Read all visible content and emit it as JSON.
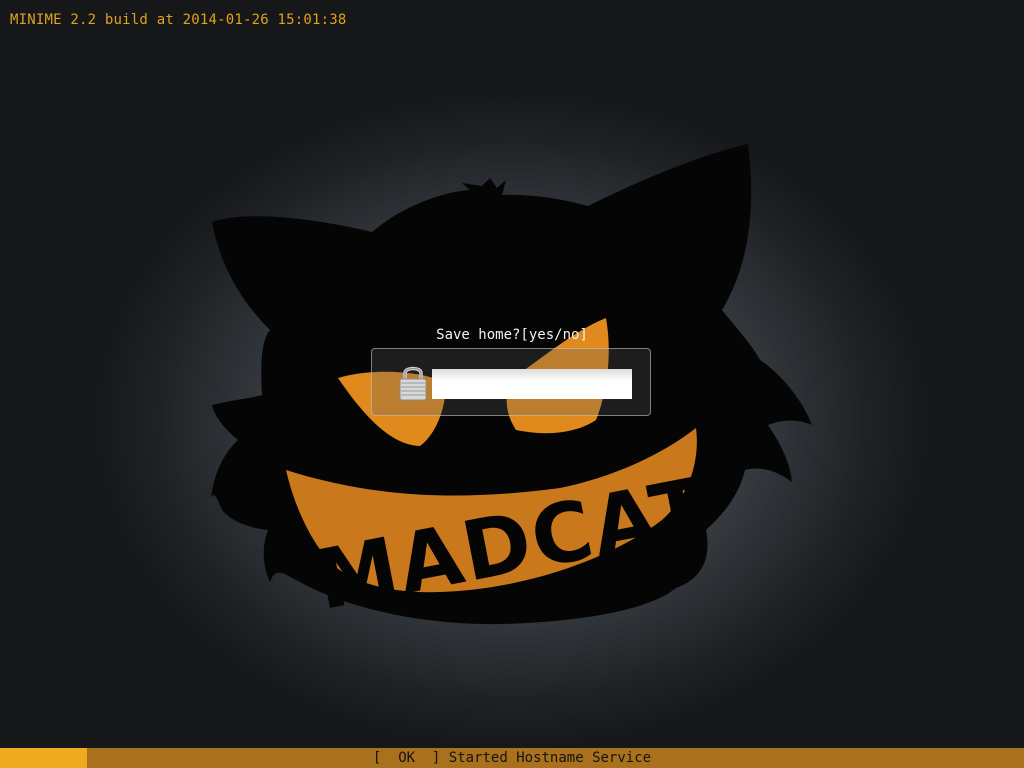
{
  "header": {
    "build_info": "MINIME 2.2 build at 2014-01-26 15:01:38"
  },
  "logo": {
    "text": "MADCAT",
    "icon": "madcat-logo"
  },
  "login": {
    "prompt": "Save home?[yes/no]",
    "input_value": "",
    "lock_icon": "lock-icon"
  },
  "status": {
    "message": "[  OK  ] Started Hostname Service",
    "progress_fraction": 0.085
  },
  "colors": {
    "accent": "#e0a21e",
    "status_bar": "#a9711c",
    "progress_fill": "#f0aa1f",
    "cat_eye": "#e08a1e"
  }
}
